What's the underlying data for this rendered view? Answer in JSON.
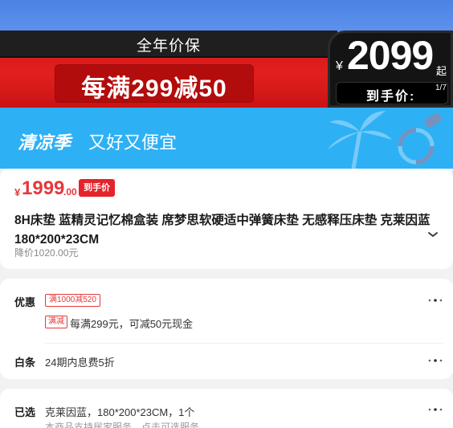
{
  "promo": {
    "subtitle": "全年价保",
    "headline": "每满299减50",
    "price_symbol": "¥",
    "price": "2099",
    "price_suffix": "起",
    "price_label": "到手价:",
    "page_indicator": "1/7"
  },
  "season": {
    "brand": "清凉季",
    "slogan": "又好又便宜"
  },
  "product": {
    "price_symbol": "¥",
    "price_int": "1999",
    "price_dec": ".00",
    "price_badge": "到手价",
    "title": "8H床垫 蓝精灵记忆棉盒装 席梦思软硬适中弹簧床垫 无感释压床垫 克莱因蓝 180*200*23CM",
    "original_price": "降价1020.00元"
  },
  "offers": {
    "label": "优惠",
    "tag": "满1000减520",
    "sub_tag": "满减",
    "detail": "每满299元，可减50元现金"
  },
  "baitiao": {
    "label": "白条",
    "detail": "24期内息费5折"
  },
  "selected": {
    "label": "已选",
    "value": "克莱因蓝，180*200*23CM，1个",
    "sub": "本商品支持居家服务，点击可选服务"
  },
  "colors": {
    "accent_red": "#e4393c",
    "banner_blue": "#2eb0f5",
    "top_blue": "#4c83e4"
  }
}
